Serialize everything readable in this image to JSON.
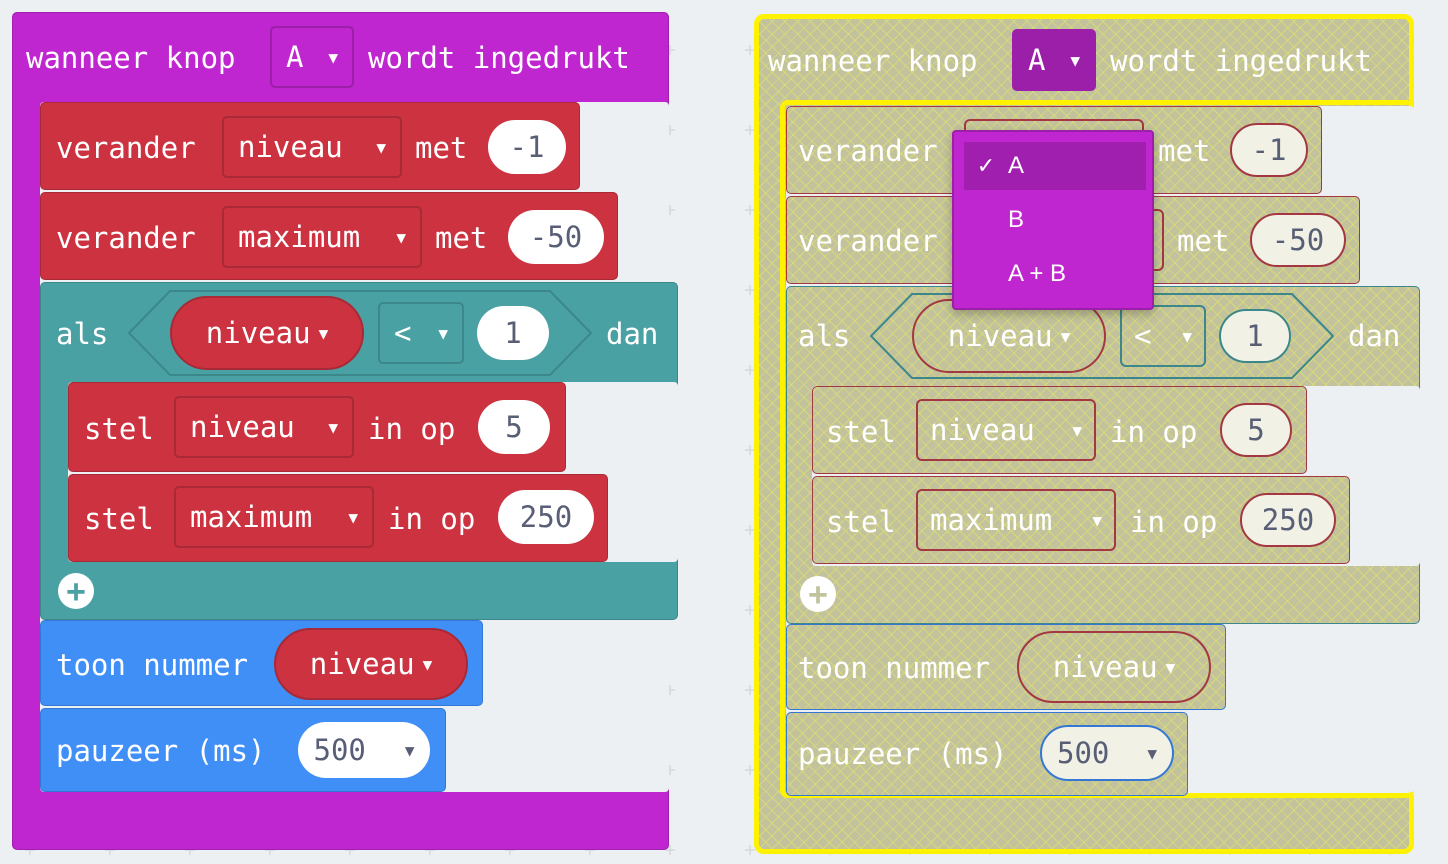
{
  "colors": {
    "event": "#c026cf",
    "variables": "#cc3240",
    "logic": "#4aa1a3",
    "basic": "#3f8ff7",
    "selection": "#fff200",
    "menu": "#c026cf"
  },
  "left_script": {
    "event": {
      "before": "wanneer knop",
      "button": "A",
      "after": "wordt ingedrukt"
    },
    "change1": {
      "verb": "verander",
      "var": "niveau",
      "mid": "met",
      "value": "-1"
    },
    "change2": {
      "verb": "verander",
      "var": "maximum",
      "mid": "met",
      "value": "-50"
    },
    "if": {
      "keyword": "als",
      "var": "niveau",
      "op": "<",
      "value": "1",
      "then": "dan"
    },
    "set1": {
      "verb": "stel",
      "var": "niveau",
      "mid": "in op",
      "value": "5"
    },
    "set2": {
      "verb": "stel",
      "var": "maximum",
      "mid": "in op",
      "value": "250"
    },
    "show": {
      "label": "toon nummer",
      "var": "niveau"
    },
    "pause": {
      "label": "pauzeer (ms)",
      "value": "500"
    }
  },
  "right_script": {
    "event": {
      "before": "wanneer knop",
      "button": "A",
      "after": "wordt ingedrukt"
    },
    "change1": {
      "verb": "verander",
      "mid": "met",
      "value": "-1"
    },
    "change2": {
      "verb": "verander",
      "mid": "met",
      "value": "-50"
    },
    "if": {
      "keyword": "als",
      "var": "niveau",
      "op": "<",
      "value": "1",
      "then": "dan"
    },
    "set1": {
      "verb": "stel",
      "var": "niveau",
      "mid": "in op",
      "value": "5"
    },
    "set2": {
      "verb": "stel",
      "var": "maximum",
      "mid": "in op",
      "value": "250"
    },
    "show": {
      "label": "toon nummer",
      "var": "niveau"
    },
    "pause": {
      "label": "pauzeer (ms)",
      "value": "500"
    }
  },
  "dropdown_menu": {
    "selected_index": 0,
    "check": "✓",
    "options": [
      "A",
      "B",
      "A + B"
    ]
  },
  "icons": {
    "caret": "▼",
    "add": "+"
  }
}
